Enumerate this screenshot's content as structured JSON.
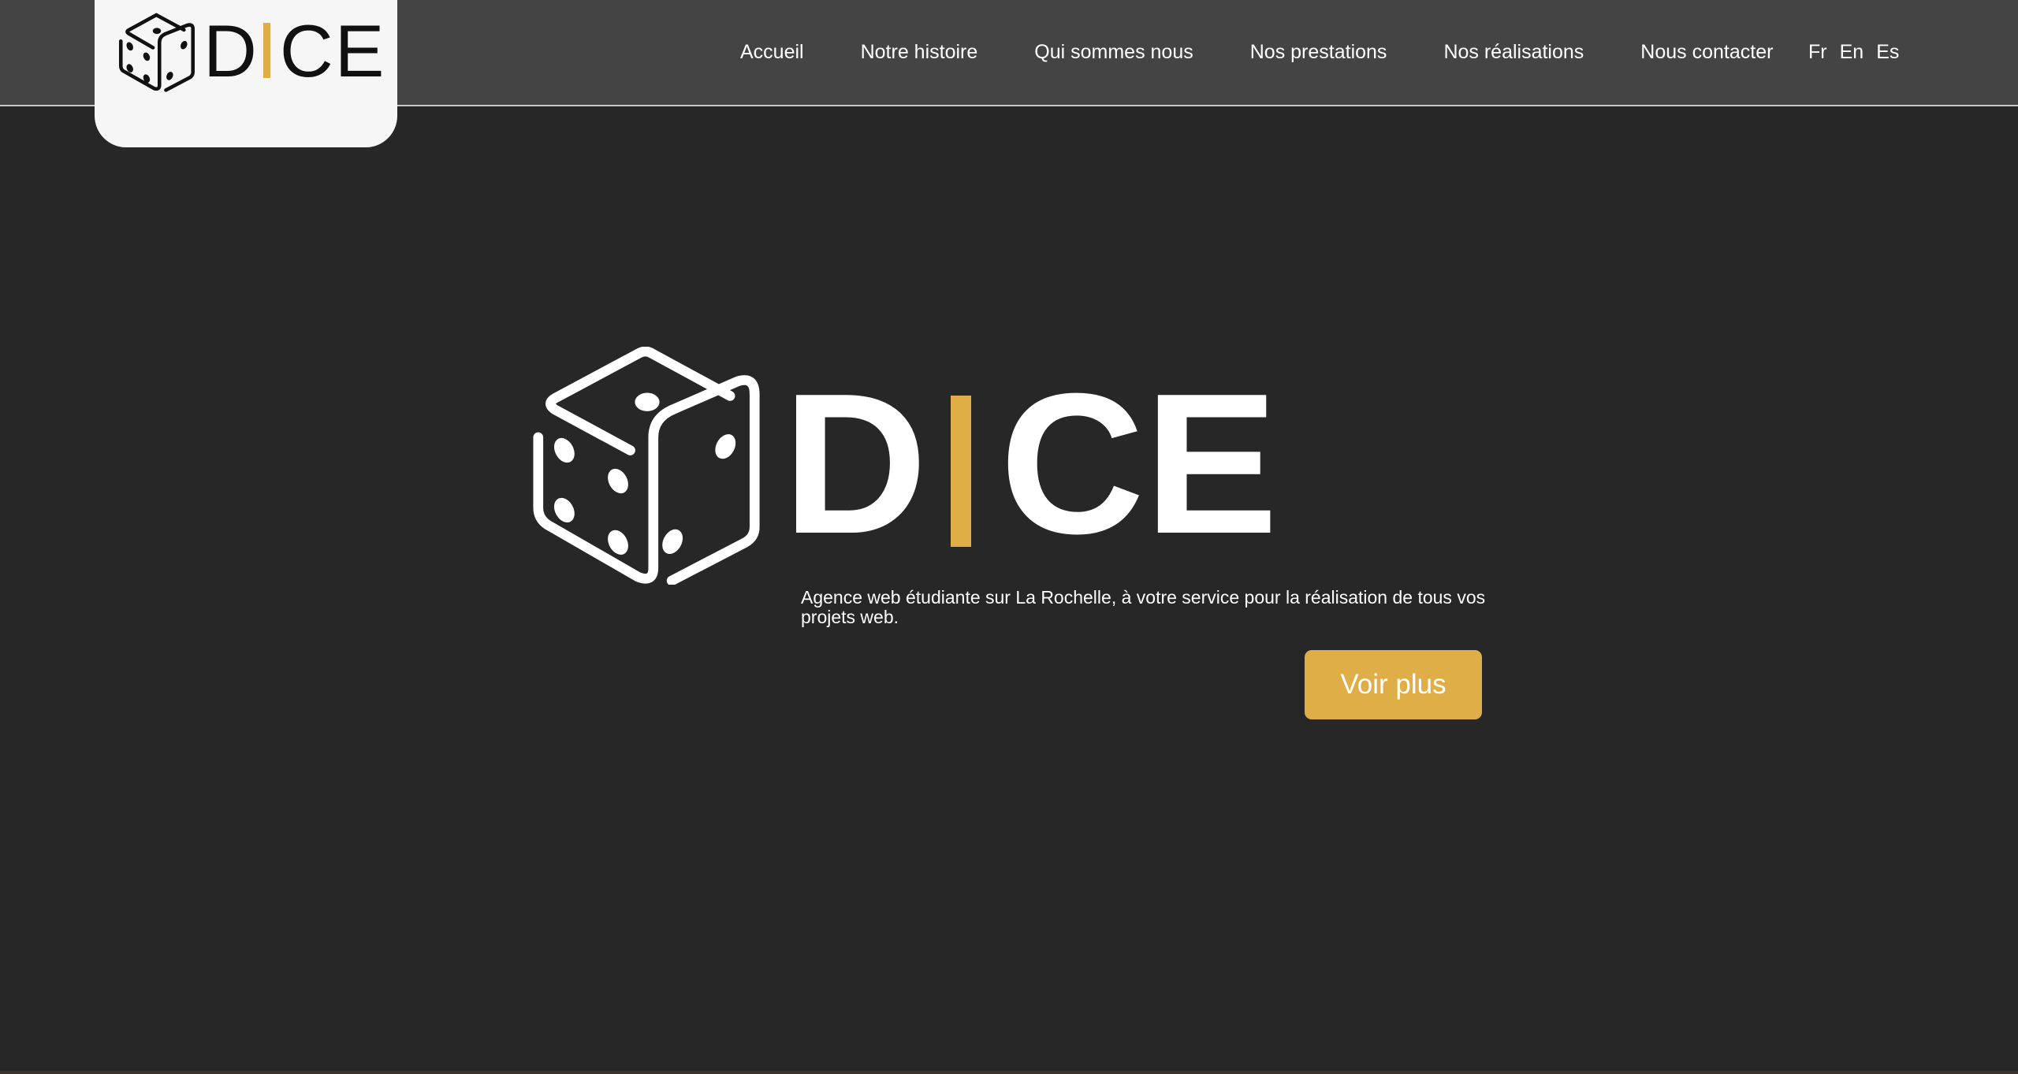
{
  "brand": {
    "name_left": "D",
    "name_right": "CE",
    "accent_color": "#e0ae47",
    "logo_icon": "dice-icon"
  },
  "nav": {
    "items": [
      {
        "label": "Accueil"
      },
      {
        "label": "Notre histoire"
      },
      {
        "label": "Qui sommes nous"
      },
      {
        "label": "Nos prestations"
      },
      {
        "label": "Nos réalisations"
      },
      {
        "label": "Nous contacter"
      }
    ]
  },
  "languages": [
    "Fr",
    "En",
    "Es"
  ],
  "hero": {
    "title_left": "D",
    "title_right": "CE",
    "tagline": "Agence web étudiante sur La Rochelle, à votre service pour la réalisation de tous vos projets web.",
    "cta_label": "Voir plus"
  },
  "colors": {
    "header_bg": "#454445",
    "page_bg": "#272727",
    "logo_box_bg": "#f6f6f6",
    "accent": "#e0ae47"
  }
}
